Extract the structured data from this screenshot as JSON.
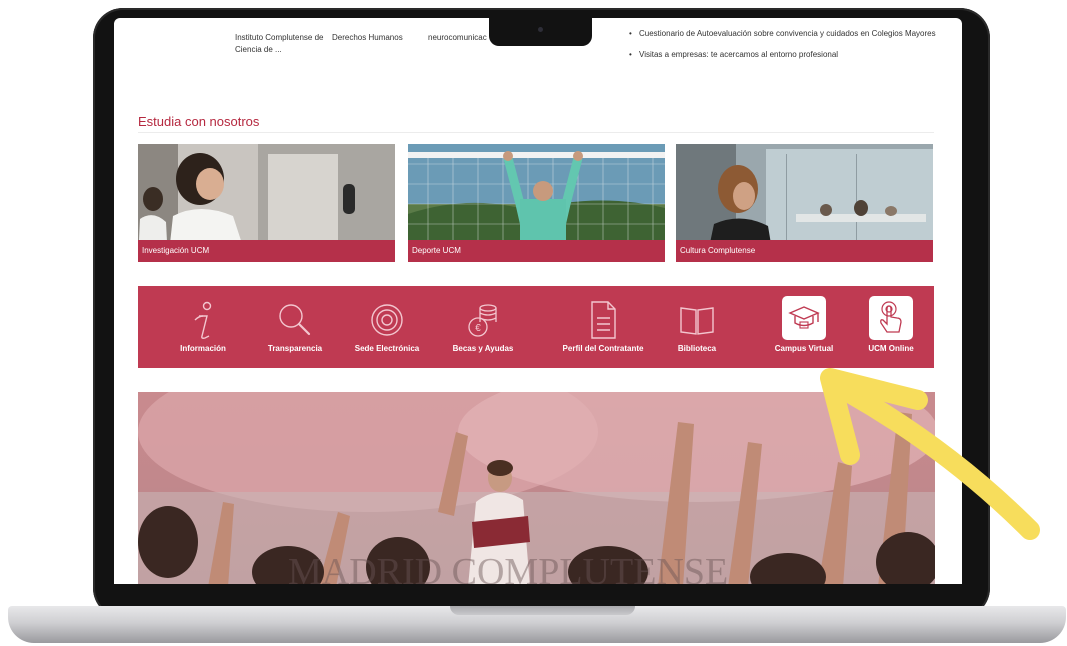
{
  "top": {
    "col1": "Instituto Complutense de Ciencia de ...",
    "col2": "Derechos Humanos",
    "col3": "neurocomunicac",
    "bullets": [
      "Cuestionario de Autoevaluación sobre convivencia y cuidados en Colegios Mayores",
      "Visitas a empresas: te acercamos al entorno profesional"
    ]
  },
  "section_title": "Estudia con nosotros",
  "cards": [
    {
      "caption": "Investigación UCM"
    },
    {
      "caption": "Deporte UCM"
    },
    {
      "caption": "Cultura Complutense"
    }
  ],
  "quick_links": [
    {
      "label": "Información",
      "icon": "info-icon"
    },
    {
      "label": "Transparencia",
      "icon": "magnifier-icon"
    },
    {
      "label": "Sede Electrónica",
      "icon": "sede-electronica-icon"
    },
    {
      "label": "Becas y Ayudas",
      "icon": "coins-icon"
    },
    {
      "label": "Perfil del Contratante",
      "icon": "document-icon"
    },
    {
      "label": "Biblioteca",
      "icon": "book-icon"
    },
    {
      "label": "Campus Virtual",
      "icon": "graduation-cap-icon"
    },
    {
      "label": "UCM Online",
      "icon": "touch-hand-icon"
    }
  ],
  "colors": {
    "brand": "#bf3a52",
    "title": "#b5283f",
    "arrow": "#f7dd5c"
  }
}
